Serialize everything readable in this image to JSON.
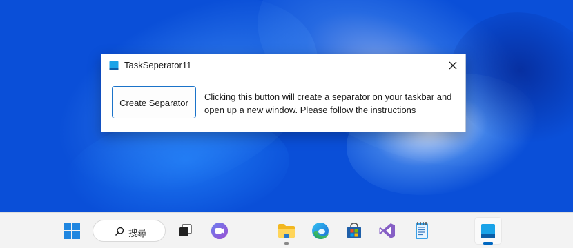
{
  "window": {
    "title": "TaskSeperator11",
    "app_icon": "taskseparator-icon",
    "close_icon": "close-icon"
  },
  "dialog": {
    "button_label": "Create Separator",
    "instructions": "Clicking this button will create a separator on your taskbar and open up a new window. Please follow the instructions"
  },
  "taskbar": {
    "search_label": "搜尋",
    "items": [
      {
        "name": "start-button",
        "icon": "windows-start-icon"
      },
      {
        "name": "search-box",
        "icon": "search-icon"
      },
      {
        "name": "task-view",
        "icon": "task-view-icon"
      },
      {
        "name": "chat",
        "icon": "teams-chat-icon"
      },
      {
        "name": "file-explorer",
        "icon": "folder-icon"
      },
      {
        "name": "edge",
        "icon": "edge-icon"
      },
      {
        "name": "store",
        "icon": "store-icon"
      },
      {
        "name": "visual-studio",
        "icon": "visual-studio-icon"
      },
      {
        "name": "notepad",
        "icon": "notepad-icon"
      },
      {
        "name": "taskseparator",
        "icon": "taskseparator-icon"
      }
    ]
  },
  "colors": {
    "accent": "#0067c0",
    "button_border": "#1b73c9",
    "taskbar_bg": "#f3f3f3",
    "wallpaper_primary": "#0b45d0"
  }
}
